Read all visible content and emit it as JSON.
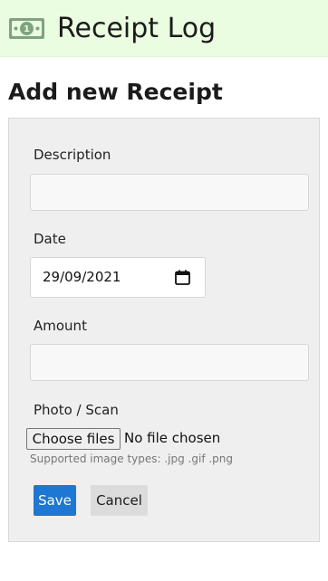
{
  "header": {
    "title": "Receipt Log",
    "logo_icon": "banknote-icon",
    "background_color": "#eafde0"
  },
  "page": {
    "heading": "Add new Receipt"
  },
  "form": {
    "description": {
      "label": "Description",
      "value": ""
    },
    "date": {
      "label": "Date",
      "value": "29/09/2021",
      "icon": "calendar-icon"
    },
    "amount": {
      "label": "Amount",
      "value": ""
    },
    "photo": {
      "label": "Photo / Scan",
      "button_label": "Choose files",
      "status": "No file chosen",
      "help": "Supported image types: .jpg .gif .png"
    },
    "actions": {
      "save_label": "Save",
      "cancel_label": "Cancel",
      "save_color": "#1e77d2"
    }
  }
}
